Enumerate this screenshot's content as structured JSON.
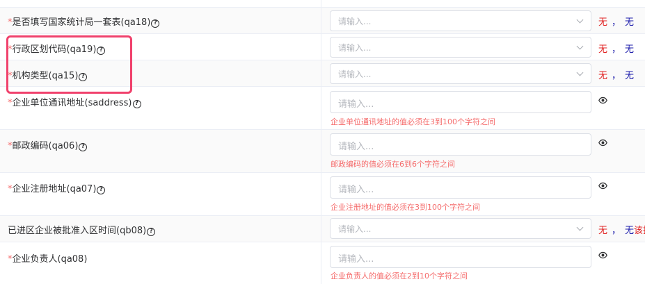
{
  "rows": [
    {
      "label": "是否填写国家统计局一套表(qa18)",
      "required": "*",
      "help": "?",
      "placeholder": "请输入...",
      "status_left": "无",
      "status_sep": "，",
      "status_right": "无"
    },
    {
      "label": "行政区划代码(qa19)",
      "required": "*",
      "help": "?",
      "placeholder": "请输入...",
      "status_left": "无",
      "status_sep": "，",
      "status_right": "无"
    },
    {
      "label": "机构类型(qa15)",
      "required": "*",
      "help": "?",
      "placeholder": "请输入...",
      "status_left": "无",
      "status_sep": "，",
      "status_right": "无"
    },
    {
      "label": "企业单位通讯地址(saddress)",
      "required": "*",
      "help": "?",
      "placeholder": "请输入...",
      "error": "企业单位通讯地址的值必须在3到100个字符之间"
    },
    {
      "label": "邮政编码(qa06)",
      "required": "*",
      "help": "?",
      "placeholder": "请输入...",
      "error": "邮政编码的值必须在6到6个字符之间"
    },
    {
      "label": "企业注册地址(qa07)",
      "required": "*",
      "help": "?",
      "placeholder": "请输入...",
      "error": "企业注册地址的值必须在3到100个字符之间"
    },
    {
      "label": "已进区企业被批准入区时间(qb08)",
      "help": "?",
      "placeholder": "请输入...",
      "status_left": "无",
      "status_sep": "，",
      "status_right": "无",
      "status_overflow": "该指"
    },
    {
      "label": "企业负责人(qa08)",
      "required": "*",
      "placeholder": "请输入...",
      "error": "企业负责人的值必须在2到10个字符之间"
    }
  ],
  "icons": {
    "select_arrow": "chevron-down-icon",
    "visibility": "eye-icon",
    "help": "question-circle-icon"
  },
  "colors": {
    "required": "#f56c6c",
    "error_text": "#f56c6c",
    "status_red": "#e02020",
    "status_blue": "#1a1aaa",
    "highlight": "#f0416c"
  }
}
